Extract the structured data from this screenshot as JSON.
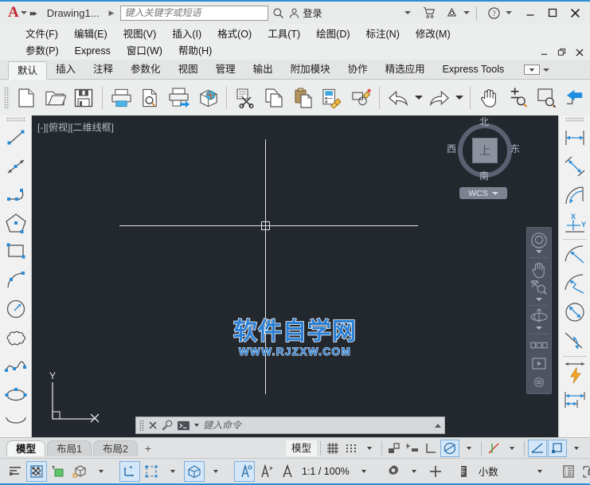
{
  "titlebar": {
    "logo": "A",
    "doc_name": "Drawing1...",
    "search_placeholder": "键入关键字或短语",
    "search_value": "",
    "signin_label": "登录",
    "icons": {
      "quick_access_more": "chevron-down-icon",
      "fast_forward": "double-arrow-icon",
      "doc_arrow": "chevron-right-icon",
      "search": "search-icon",
      "account": "person-icon",
      "store": "cart-icon",
      "autodesk": "autodesk-icon",
      "help": "question-circle-icon"
    },
    "window": {
      "minimize": "minimize-icon",
      "maximize": "maximize-icon",
      "close": "close-icon"
    }
  },
  "menubar": {
    "row1": [
      "文件(F)",
      "编辑(E)",
      "视图(V)",
      "插入(I)",
      "格式(O)",
      "工具(T)",
      "绘图(D)",
      "标注(N)",
      "修改(M)"
    ],
    "row2": [
      "参数(P)",
      "Express",
      "窗口(W)",
      "帮助(H)"
    ],
    "window_controls": {
      "minimize": "minimize-icon",
      "restore": "restore-icon",
      "close": "close-icon"
    }
  },
  "ribbon": {
    "tabs": [
      {
        "label": "默认",
        "active": true
      },
      {
        "label": "插入",
        "active": false
      },
      {
        "label": "注释",
        "active": false
      },
      {
        "label": "参数化",
        "active": false
      },
      {
        "label": "视图",
        "active": false
      },
      {
        "label": "管理",
        "active": false
      },
      {
        "label": "输出",
        "active": false
      },
      {
        "label": "附加模块",
        "active": false
      },
      {
        "label": "协作",
        "active": false
      },
      {
        "label": "精选应用",
        "active": false
      },
      {
        "label": "Express Tools",
        "active": false
      }
    ],
    "panel_toggle": "panel-dropdown-icon"
  },
  "toolbar": {
    "buttons": [
      {
        "name": "new-file-button",
        "icon": "new-document-icon"
      },
      {
        "name": "open-file-button",
        "icon": "open-folder-icon"
      },
      {
        "name": "save-file-button",
        "icon": "floppy-save-icon"
      },
      {
        "name": "plot-button",
        "icon": "printer-icon"
      },
      {
        "name": "plot-preview-button",
        "icon": "page-magnifier-icon"
      },
      {
        "name": "publish-button",
        "icon": "printer-export-icon"
      },
      {
        "name": "3d-publish-button",
        "icon": "globe-box-icon"
      },
      {
        "name": "cut-button",
        "icon": "scissors-icon"
      },
      {
        "name": "copy-button",
        "icon": "copy-pages-icon"
      },
      {
        "name": "paste-button",
        "icon": "clipboard-paste-icon"
      },
      {
        "name": "match-properties-button",
        "icon": "match-props-brush-icon"
      },
      {
        "name": "block-editor-button",
        "icon": "block-edit-pencil-icon"
      },
      {
        "name": "undo-button",
        "icon": "undo-arrow-icon"
      },
      {
        "name": "undo-dropdown",
        "icon": "chevron-down-icon"
      },
      {
        "name": "redo-button",
        "icon": "redo-arrow-icon"
      },
      {
        "name": "redo-dropdown",
        "icon": "chevron-down-icon"
      },
      {
        "name": "pan-button",
        "icon": "hand-pan-icon"
      },
      {
        "name": "zoom-realtime-button",
        "icon": "zoom-plusminus-icon"
      },
      {
        "name": "zoom-window-button",
        "icon": "zoom-window-icon"
      },
      {
        "name": "zoom-previous-button",
        "icon": "zoom-previous-arrow-icon"
      }
    ]
  },
  "left_palette": {
    "grip": "drag-grip",
    "tools": [
      {
        "name": "line-tool",
        "icon": "line-icon"
      },
      {
        "name": "construction-line-tool",
        "icon": "xline-icon"
      },
      {
        "name": "polyline-tool",
        "icon": "polyline-icon"
      },
      {
        "name": "polygon-tool",
        "icon": "polygon-icon"
      },
      {
        "name": "rectangle-tool",
        "icon": "rectangle-icon"
      },
      {
        "name": "arc-tool",
        "icon": "arc-icon"
      },
      {
        "name": "circle-tool",
        "icon": "circle-radius-icon"
      },
      {
        "name": "revision-cloud-tool",
        "icon": "revcloud-icon"
      },
      {
        "name": "spline-tool",
        "icon": "spline-icon"
      },
      {
        "name": "ellipse-tool",
        "icon": "ellipse-icon"
      },
      {
        "name": "ellipse-arc-tool",
        "icon": "ellipse-arc-icon"
      }
    ]
  },
  "right_palette": {
    "grip": "drag-grip",
    "tools": [
      {
        "name": "linear-dimension-tool",
        "icon": "linear-dim-icon"
      },
      {
        "name": "aligned-dimension-tool",
        "icon": "aligned-dim-icon"
      },
      {
        "name": "arc-length-dimension-tool",
        "icon": "arclength-dim-icon"
      },
      {
        "name": "ordinate-dimension-tool",
        "icon": "ordinate-dim-icon"
      },
      {
        "name": "radius-dimension-tool",
        "icon": "radius-dim-icon"
      },
      {
        "name": "jogged-dimension-tool",
        "icon": "jogged-dim-icon"
      },
      {
        "name": "diameter-dimension-tool",
        "icon": "diameter-dim-icon"
      },
      {
        "name": "angular-dimension-tool",
        "icon": "angular-dim-icon"
      },
      {
        "name": "quick-dimension-tool",
        "icon": "quick-dim-lightning-icon"
      },
      {
        "name": "baseline-dimension-tool",
        "icon": "baseline-dim-icon"
      }
    ]
  },
  "canvas": {
    "viewport_label": "[-][俯视][二维线框]",
    "background_color": "#23272e",
    "crosshair_color": "#e3e5e8",
    "watermark_cn": "软件自学网",
    "watermark_en": "WWW.RJZXW.COM",
    "watermark_color": "#2a7fd4",
    "ucs_axis_label": "Y",
    "viewcube": {
      "top_face": "上",
      "north": "北",
      "south": "南",
      "west": "西",
      "east": "东",
      "wcs_label": "WCS",
      "wcs_caret": "chevron-down-icon"
    },
    "navbar": [
      {
        "name": "steering-wheel-button",
        "icon": "steering-wheel-icon"
      },
      {
        "name": "navbar-wheel-dropdown",
        "icon": "chevron-down-icon"
      },
      {
        "name": "pan-button",
        "icon": "hand-pan-icon"
      },
      {
        "name": "zoom-extents-button",
        "icon": "zoom-extents-icon"
      },
      {
        "name": "navbar-zoom-dropdown",
        "icon": "chevron-down-icon"
      },
      {
        "name": "orbit-button",
        "icon": "orbit-icon"
      },
      {
        "name": "navbar-orbit-dropdown",
        "icon": "chevron-down-icon"
      },
      {
        "name": "showmotion-button",
        "icon": "showmotion-icon"
      },
      {
        "name": "navbar-customize-button",
        "icon": "navbar-menu-icon"
      }
    ],
    "navbar_close": "close-icon"
  },
  "command_line": {
    "close_icon": "close-icon",
    "settings_icon": "wrench-icon",
    "prompt_icon": "console-prompt-icon",
    "prompt_caret": "chevron-down-icon",
    "placeholder": "键入命令",
    "value": "",
    "expand_icon": "chevron-up-icon"
  },
  "layout_tabs": {
    "tabs": [
      {
        "label": "模型",
        "active": true
      },
      {
        "label": "布局1",
        "active": false
      },
      {
        "label": "布局2",
        "active": false
      }
    ],
    "add_label": "+"
  },
  "status_bar": {
    "space_label": "模型",
    "items": [
      {
        "name": "grid-display-toggle",
        "icon": "grid-icon",
        "on": false
      },
      {
        "name": "snap-mode-toggle",
        "icon": "snap-dots-icon",
        "on": false
      },
      {
        "name": "snap-dropdown",
        "icon": "chevron-down-icon",
        "on": false
      },
      {
        "name": "infer-constraints-toggle",
        "icon": "infer-constraints-icon",
        "on": false
      },
      {
        "name": "dynamic-input-toggle",
        "icon": "dynamic-input-icon",
        "on": false
      },
      {
        "name": "ortho-mode-toggle",
        "icon": "ortho-icon",
        "on": false
      },
      {
        "name": "polar-tracking-toggle",
        "icon": "polar-tracking-icon",
        "on": true
      },
      {
        "name": "polar-dropdown",
        "icon": "chevron-down-icon",
        "on": false
      },
      {
        "name": "object-snap-tracking-toggle",
        "icon": "osnap-tracking-icon",
        "on": false
      },
      {
        "name": "osnap-dropdown",
        "icon": "chevron-down-icon",
        "on": false
      },
      {
        "name": "object-snap-toggle",
        "icon": "object-snap-icon",
        "on": true
      },
      {
        "name": "lineweight-toggle",
        "icon": "lineweight-icon",
        "on": true
      },
      {
        "name": "lineweight-dropdown",
        "icon": "chevron-down-icon",
        "on": false
      }
    ]
  },
  "bottom_bar": {
    "zoom_scale": "1:1 / 100%",
    "units": "小数",
    "items": [
      {
        "name": "transparency-toggle",
        "icon": "transparency-lines-icon",
        "on": false
      },
      {
        "name": "selection-cycling-toggle",
        "icon": "checker-select-icon",
        "on": true
      },
      {
        "name": "annotation-monitor-toggle",
        "icon": "annotation-monitor-icon",
        "on": false
      },
      {
        "name": "isometric-drafting-toggle",
        "icon": "iso-cube-icon",
        "on": false
      },
      {
        "name": "iso-dropdown",
        "icon": "chevron-down-icon",
        "on": false
      },
      {
        "name": "dynamic-ucs-toggle",
        "icon": "dynamic-ucs-icon",
        "on": true
      },
      {
        "name": "selection-filter-toggle",
        "icon": "selection-filter-icon",
        "on": false
      },
      {
        "name": "filter-dropdown",
        "icon": "chevron-down-icon",
        "on": false
      },
      {
        "name": "gizmo-toggle",
        "icon": "gizmo-icon",
        "on": true
      },
      {
        "name": "gizmo-dropdown",
        "icon": "chevron-down-icon",
        "on": false
      },
      {
        "name": "annotation-visibility-toggle",
        "icon": "annotation-visibility-icon",
        "on": true
      },
      {
        "name": "autoscale-toggle",
        "icon": "autoscale-icon",
        "on": false
      },
      {
        "name": "annotation-scale-toggle",
        "icon": "annotation-scale-icon",
        "on": false
      },
      {
        "name": "scale-dropdown",
        "icon": "chevron-down-icon",
        "on": false
      },
      {
        "name": "workspace-switching-button",
        "icon": "gear-icon",
        "on": false
      },
      {
        "name": "workspace-dropdown",
        "icon": "chevron-down-icon",
        "on": false
      },
      {
        "name": "toolbar-lock-button",
        "icon": "plus-cross-icon",
        "on": false
      },
      {
        "name": "units-icon",
        "icon": "ruler-units-icon",
        "on": false
      },
      {
        "name": "units-dropdown",
        "icon": "chevron-down-icon",
        "on": false
      },
      {
        "name": "quick-properties-toggle",
        "icon": "quick-props-icon",
        "on": false
      },
      {
        "name": "isolate-objects-button",
        "icon": "isolate-lock-icon",
        "on": false
      },
      {
        "name": "isolate-dropdown",
        "icon": "chevron-down-icon",
        "on": false
      },
      {
        "name": "graphics-performance-button",
        "icon": "hardware-accel-icon",
        "on": false
      },
      {
        "name": "clean-screen-toggle",
        "icon": "clean-screen-circle-icon",
        "on": true
      },
      {
        "name": "fullscreen-button",
        "icon": "expand-arrows-icon",
        "on": false
      },
      {
        "name": "customization-button",
        "icon": "hamburger-menu-icon",
        "on": false
      }
    ]
  }
}
